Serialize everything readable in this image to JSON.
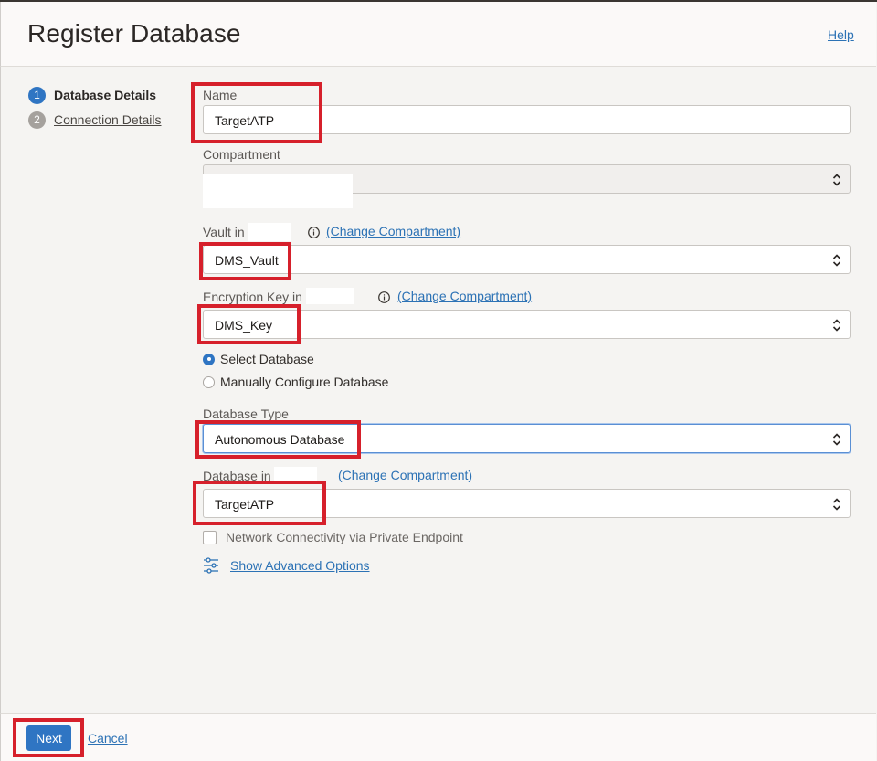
{
  "header": {
    "title": "Register Database",
    "help_label": "Help"
  },
  "steps": [
    {
      "number": "1",
      "label": "Database Details",
      "active": true
    },
    {
      "number": "2",
      "label": "Connection Details",
      "active": false
    }
  ],
  "form": {
    "name": {
      "label": "Name",
      "value": "TargetATP"
    },
    "compartment": {
      "label": "Compartment",
      "value": ""
    },
    "vault": {
      "label": "Vault in",
      "value": "DMS_Vault",
      "change_link": "(Change Compartment)"
    },
    "encryption_key": {
      "label": "Encryption Key in",
      "value": "DMS_Key",
      "change_link": "(Change Compartment)"
    },
    "database_source": {
      "options": [
        "Select Database",
        "Manually Configure Database"
      ],
      "selected": "Select Database"
    },
    "database_type": {
      "label": "Database Type",
      "value": "Autonomous Database"
    },
    "database": {
      "label": "Database in",
      "value": "TargetATP",
      "change_link": "(Change Compartment)"
    },
    "private_endpoint": {
      "label": "Network Connectivity via Private Endpoint",
      "checked": false
    },
    "advanced_options_label": "Show Advanced Options"
  },
  "footer": {
    "next_label": "Next",
    "cancel_label": "Cancel"
  },
  "colors": {
    "accent": "#2f75c3",
    "link": "#2c72b5",
    "highlight": "#d6202b"
  }
}
